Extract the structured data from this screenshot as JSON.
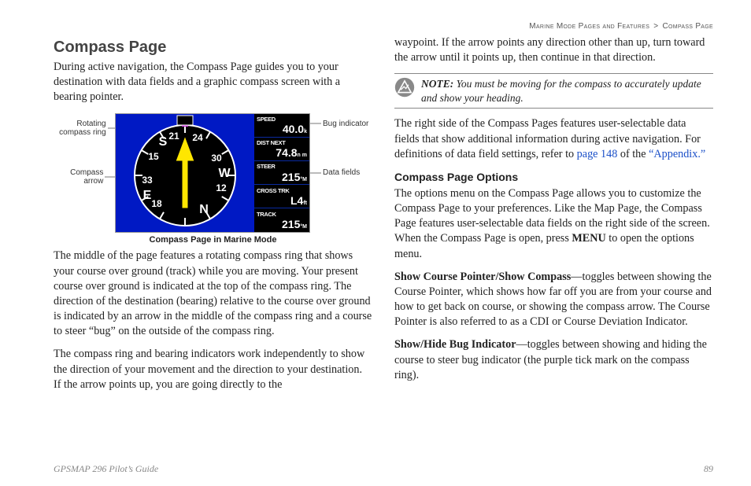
{
  "breadcrumb": {
    "section": "Marine Mode Pages and Features",
    "sep": ">",
    "page": "Compass Page"
  },
  "left": {
    "title": "Compass Page",
    "intro": "During active navigation, the Compass Page guides you to your destination with data fields and a graphic compass screen with a bearing pointer.",
    "callouts": {
      "rotating_ring": "Rotating compass ring",
      "compass_arrow": "Compass arrow",
      "bug_indicator": "Bug indicator",
      "data_fields": "Data fields"
    },
    "compass_numbers": [
      "21",
      "24",
      "15",
      "33",
      "12",
      "30",
      "18"
    ],
    "cardinals": {
      "S": "S",
      "W": "W",
      "E": "E",
      "N": "N"
    },
    "datafields": [
      {
        "label": "SPEED",
        "value": "40.0",
        "unit": "k"
      },
      {
        "label": "DIST NEXT",
        "value": "74.8",
        "unit": "n m"
      },
      {
        "label": "STEER",
        "value": "215",
        "unit": "°M"
      },
      {
        "label": "CROSS TRK",
        "value": "L4",
        "unit": "ft"
      },
      {
        "label": "TRACK",
        "value": "215",
        "unit": "°M"
      }
    ],
    "caption": "Compass Page in Marine Mode",
    "para2": "The middle of the page features a rotating compass ring that shows your course over ground (track) while you are moving. Your present course over ground is indicated at the top of the compass ring. The direction of the destination (bearing) relative to the course over ground is indicated by an arrow in the middle of the compass ring and a course to steer “bug” on the outside of the compass ring.",
    "para3": "The compass ring and bearing indicators work independently to show the direction of your movement and the direction to your destination. If the arrow points up, you are going directly to the"
  },
  "right": {
    "para1": "waypoint. If the arrow points any direction other than up, turn toward the arrow until it points up, then continue in that direction.",
    "note_label": "NOTE:",
    "note_body": " You must be moving for the compass to accurately update and show your heading.",
    "para2a": "The right side of the Compass Pages features user-selectable data fields that show additional information during active navigation. For definitions of data field settings, refer to ",
    "link1": "page 148",
    "para2b": " of the ",
    "link2": "“Appendix.”",
    "options_title": "Compass Page Options",
    "opt_intro_a": "The options menu on the Compass Page allows you to customize the Compass Page to your preferences. Like the Map Page, the Compass Page features user-selectable data fields on the right side of the screen. When the Compass Page is open, press ",
    "menu_kw": "MENU",
    "opt_intro_b": " to open the options menu.",
    "opt1_lead": "Show Course Pointer/Show Compass",
    "opt1_body": "—toggles between showing the Course Pointer, which shows how far off you are from your course and how to get back on course, or showing the compass arrow. The Course Pointer is also referred to as a CDI or Course Deviation Indicator.",
    "opt2_lead": "Show/Hide Bug Indicator",
    "opt2_body": "—toggles between showing and hiding the course to steer bug indicator (the purple tick mark on the compass ring)."
  },
  "footer": {
    "guide": "GPSMAP 296 Pilot’s Guide",
    "pagenum": "89"
  }
}
